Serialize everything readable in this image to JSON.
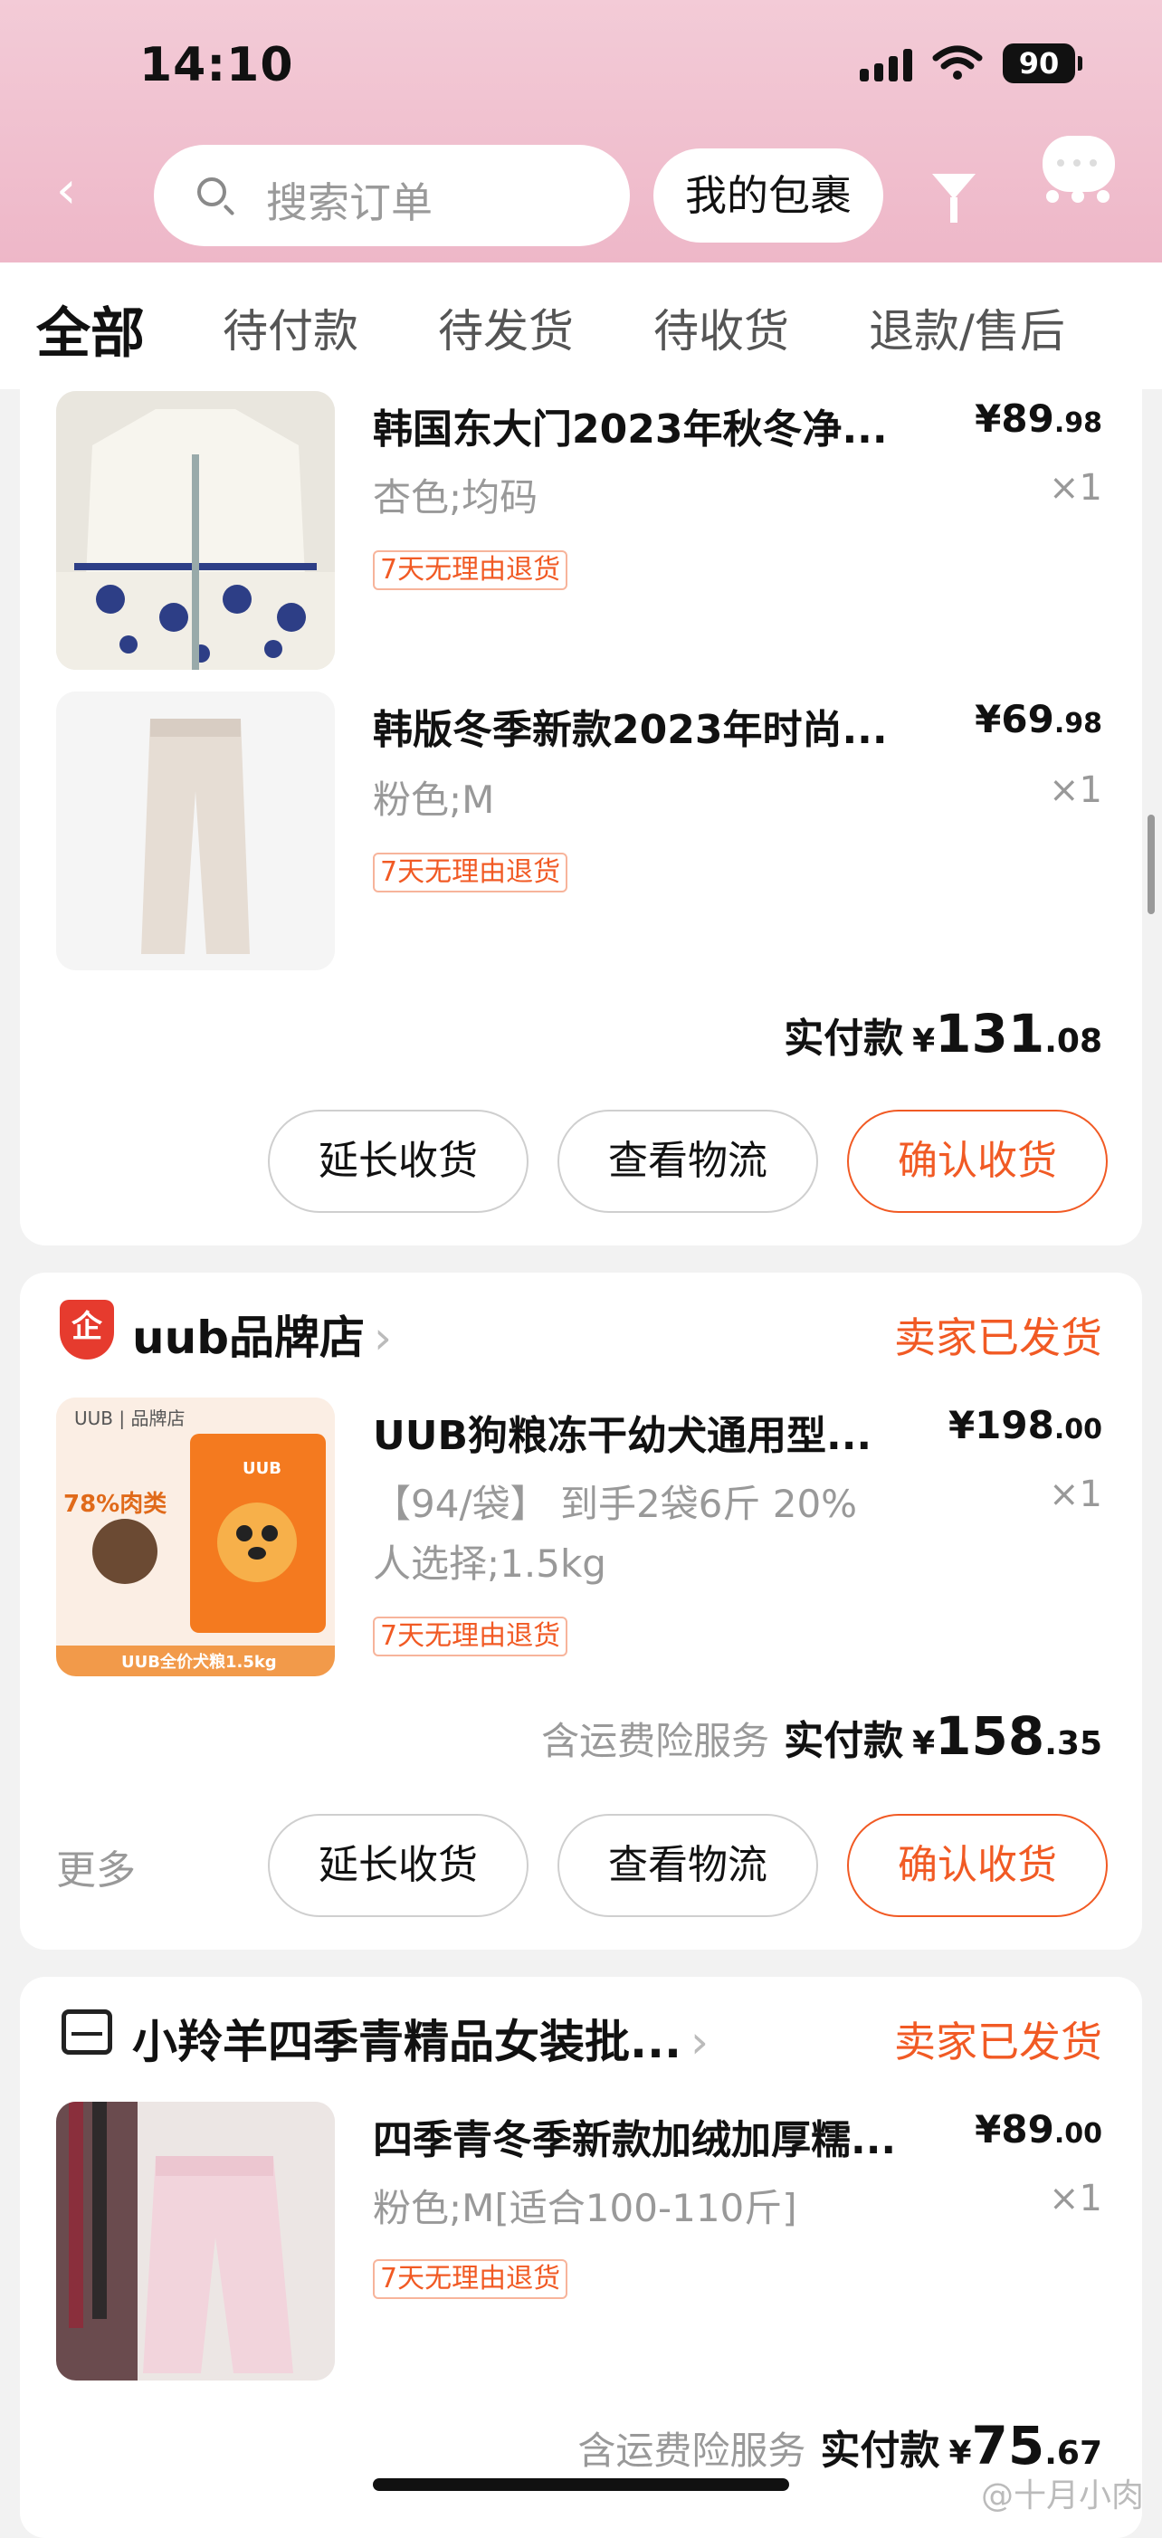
{
  "status_bar": {
    "time": "14:10",
    "battery": "90"
  },
  "header": {
    "search_placeholder": "搜索订单",
    "packages_label": "我的包裹"
  },
  "tabs": [
    "全部",
    "待付款",
    "待发货",
    "待收货",
    "退款/售后"
  ],
  "order1": {
    "items": [
      {
        "title": "韩国东大门2023年秋冬净...",
        "spec": "杏色;均码",
        "price_int": "¥89",
        "price_dec": ".98",
        "qty": "×1",
        "tag": "7天无理由退货"
      },
      {
        "title": "韩版冬季新款2023年时尚...",
        "spec": "粉色;M",
        "price_int": "¥69",
        "price_dec": ".98",
        "qty": "×1",
        "tag": "7天无理由退货"
      }
    ],
    "paid_label": "实付款",
    "paid_yen": "¥",
    "paid_int": "131",
    "paid_dec": ".08",
    "buttons": [
      "延长收货",
      "查看物流",
      "确认收货"
    ]
  },
  "order2": {
    "store": "uub品牌店",
    "status": "卖家已发货",
    "item": {
      "title": "UUB狗粮冻干幼犬通用型...",
      "spec_line1": "【94/袋】 到手2袋6斤 20%",
      "spec_line2": "人选择;1.5kg",
      "price_int": "¥198",
      "price_dec": ".00",
      "qty": "×1",
      "tag": "7天无理由退货"
    },
    "insurance": "含运费险服务",
    "paid_label": "实付款",
    "paid_yen": "¥",
    "paid_int": "158",
    "paid_dec": ".35",
    "more": "更多",
    "buttons": [
      "延长收货",
      "查看物流",
      "确认收货"
    ],
    "image_text": {
      "brand": "UUB | 品牌店",
      "meat": "78%肉类",
      "caption": "UUB全价犬粮1.5kg",
      "bag": "UUB"
    }
  },
  "order3": {
    "store": "小羚羊四季青精品女装批...",
    "status": "卖家已发货",
    "item": {
      "title": "四季青冬季新款加绒加厚糯...",
      "spec": "粉色;M[适合100-110斤]",
      "price_int": "¥89",
      "price_dec": ".00",
      "qty": "×1",
      "tag": "7天无理由退货"
    },
    "insurance": "含运费险服务",
    "paid_label": "实付款",
    "paid_yen": "¥",
    "paid_int": "75",
    "paid_dec": ".67"
  },
  "watermark": "@十月小肉"
}
